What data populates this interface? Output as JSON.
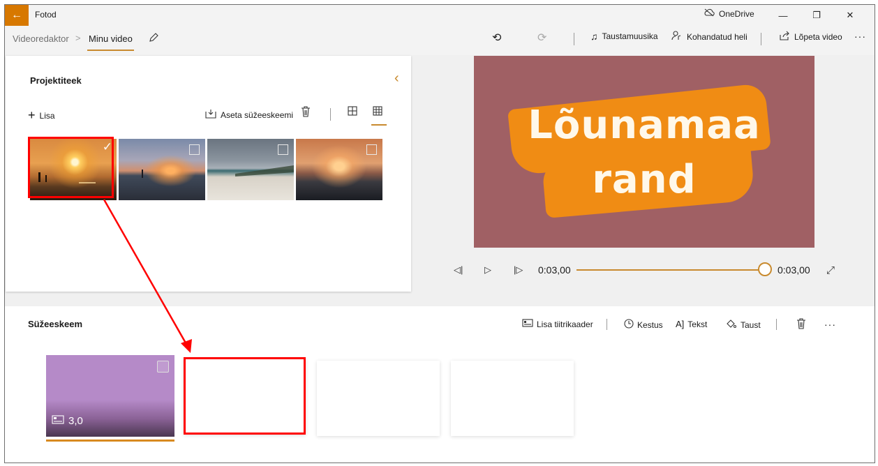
{
  "window": {
    "app_title": "Fotod",
    "onedrive_label": "OneDrive",
    "minimize_glyph": "—",
    "maximize_glyph": "❐",
    "close_glyph": "✕",
    "back_glyph": "←"
  },
  "breadcrumb": {
    "root": "Videoredaktor",
    "separator": ">",
    "current": "Minu video"
  },
  "toolbar": {
    "undo_glyph": "⟲",
    "redo_glyph": "⟳",
    "background_music": "Taustamuusika",
    "custom_audio": "Kohandatud heli",
    "finish_video": "Lõpeta video",
    "more_glyph": "···"
  },
  "library": {
    "title": "Projektiteek",
    "add_label": "Lisa",
    "place_in_storyboard": "Aseta süžeeskeemi",
    "items": [
      {
        "name": "sunset-beach-people",
        "selected": true
      },
      {
        "name": "beach-sunset-figure",
        "selected": false
      },
      {
        "name": "cloudy-white-beach",
        "selected": false
      },
      {
        "name": "sea-sunset",
        "selected": false
      }
    ]
  },
  "preview": {
    "title_line_1": "Lõunamaa",
    "title_line_2": "rand",
    "background_color": "#a06064",
    "brush_color": "#f08c14"
  },
  "playback": {
    "current_time": "0:03,00",
    "total_time": "0:03,00",
    "progress": 1.0
  },
  "storyboard": {
    "title": "Süžeeskeem",
    "add_title_card": "Lisa tiitrikaader",
    "duration": "Kestus",
    "text": "Tekst",
    "background": "Taust",
    "more_glyph": "···",
    "cards": [
      {
        "type": "title-card",
        "duration": "3,0",
        "color": "#b58ac8"
      },
      {
        "type": "empty"
      },
      {
        "type": "empty"
      },
      {
        "type": "empty"
      }
    ]
  },
  "annotation": {
    "color": "#ff0000"
  }
}
